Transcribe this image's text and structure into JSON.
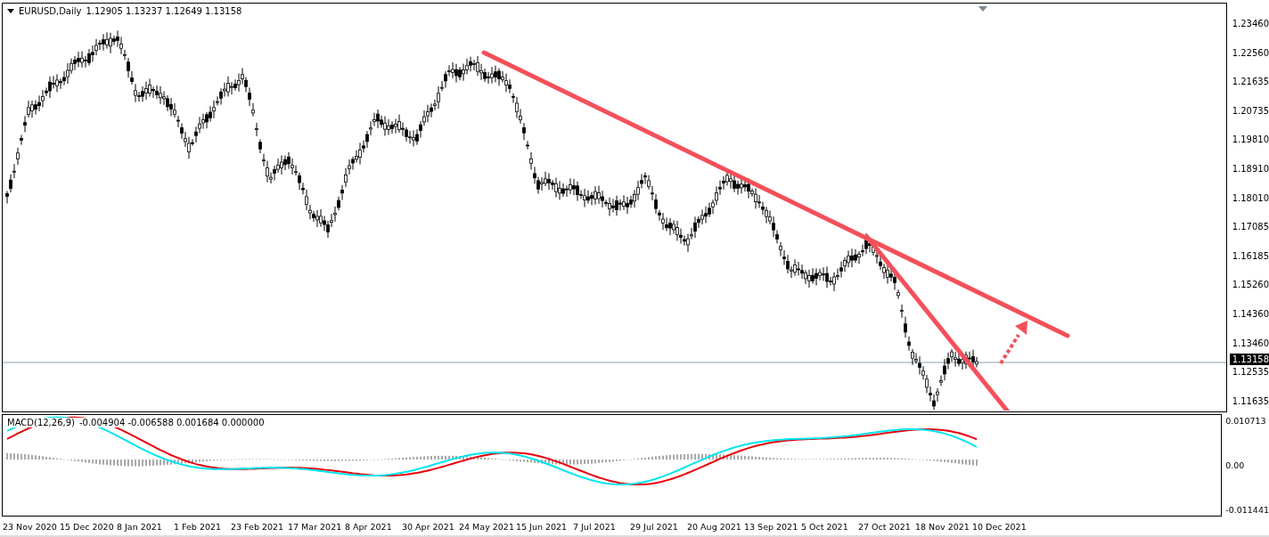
{
  "chart": {
    "symbol": "EURUSD,Daily",
    "ohlc": "1.12905 1.13237 1.12649 1.13158",
    "price_labels": [
      "1.23460",
      "1.22560",
      "1.21635",
      "1.20735",
      "1.19810",
      "1.18910",
      "1.18010",
      "1.17085",
      "1.16185",
      "1.15260",
      "1.14360",
      "1.13460",
      "1.12535",
      "1.11635"
    ],
    "current_price": "1.13158"
  },
  "indicator": {
    "title": "MACD(12,26,9)",
    "values": "-0.004904 -0.006588 0.001684 0.000000",
    "labels": [
      "0.010713",
      "0.00",
      "-0.011441"
    ]
  },
  "time_axis": {
    "labels": [
      "23 Nov 2020",
      "15 Dec 2020",
      "8 Jan 2021",
      "1 Feb 2021",
      "23 Feb 2021",
      "17 Mar 2021",
      "8 Apr 2021",
      "30 Apr 2021",
      "24 May 2021",
      "15 Jun 2021",
      "7 Jul 2021",
      "29 Jul 2021",
      "20 Aug 2021",
      "13 Sep 2021",
      "5 Oct 2021",
      "27 Oct 2021",
      "18 Nov 2021",
      "10 Dec 2021"
    ]
  }
}
